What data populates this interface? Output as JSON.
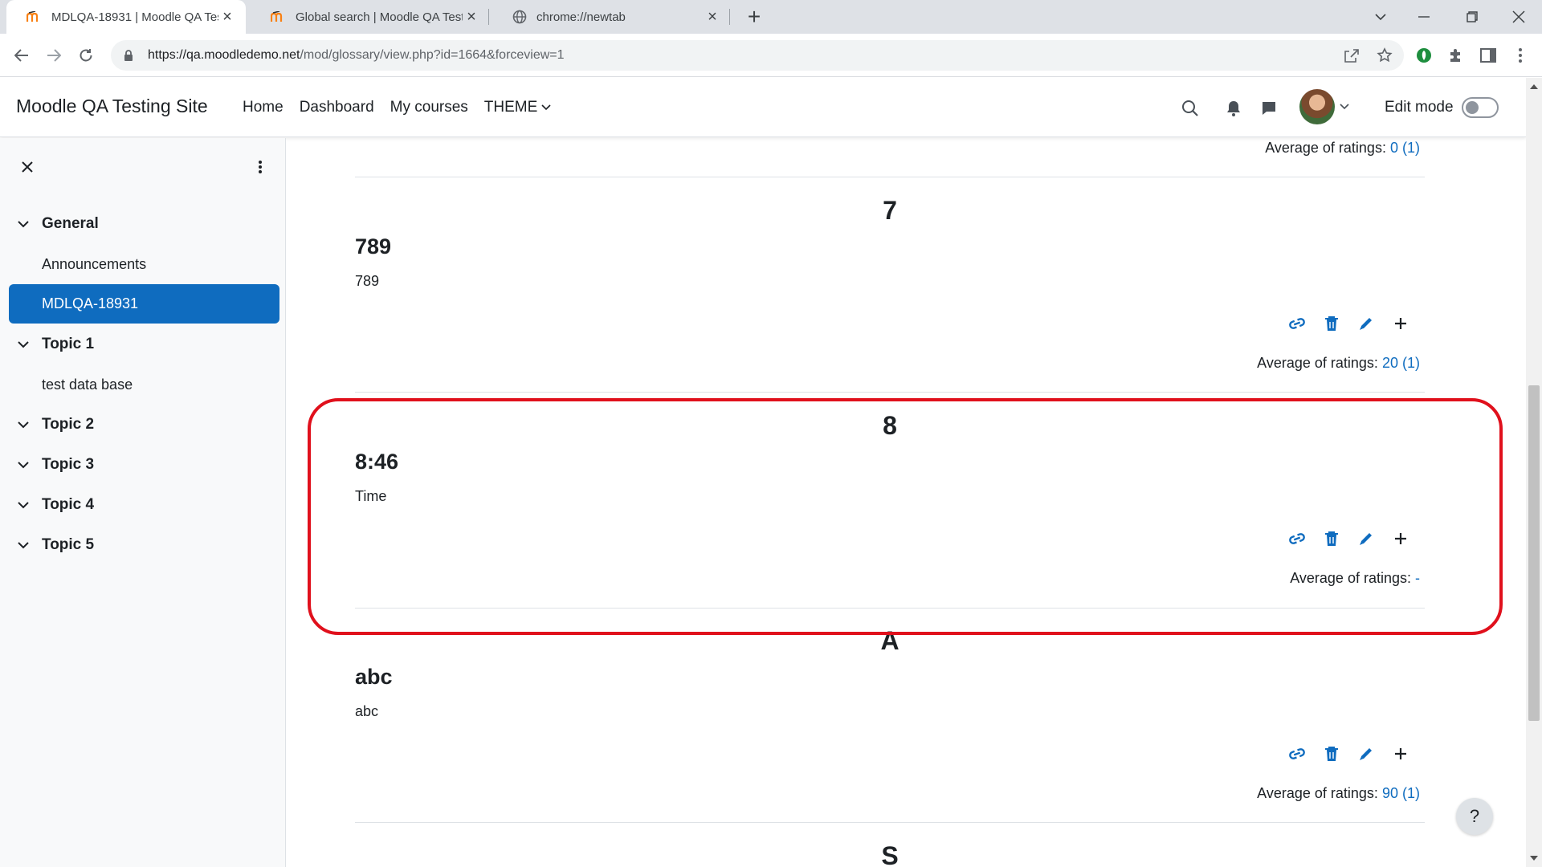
{
  "browser": {
    "tabs": [
      {
        "title": "MDLQA-18931 | Moodle QA Testi",
        "active": true
      },
      {
        "title": "Global search | Moodle QA Testin",
        "active": false
      },
      {
        "title": "chrome://newtab",
        "active": false
      }
    ],
    "url_host": "https://qa.moodledemo.net",
    "url_path": "/mod/glossary/view.php?id=1664&forceview=1"
  },
  "site": {
    "name": "Moodle QA Testing Site",
    "nav": {
      "home": "Home",
      "dashboard": "Dashboard",
      "my_courses": "My courses",
      "theme": "THEME"
    },
    "edit_mode_label": "Edit mode"
  },
  "course_index": {
    "sections": [
      {
        "title": "General",
        "items": [
          "Announcements",
          "MDLQA-18931"
        ]
      },
      {
        "title": "Topic 1",
        "items": [
          "test data base"
        ]
      },
      {
        "title": "Topic 2",
        "items": []
      },
      {
        "title": "Topic 3",
        "items": []
      },
      {
        "title": "Topic 4",
        "items": []
      },
      {
        "title": "Topic 5",
        "items": []
      }
    ],
    "active_item": "MDLQA-18931"
  },
  "glossary": {
    "rating_label": "Average of ratings:",
    "top_rating": {
      "value": "0",
      "count": "(1)"
    },
    "entries": [
      {
        "letter": "7",
        "concept": "789",
        "definition": "789",
        "rating_value": "20",
        "rating_count": "(1)"
      },
      {
        "letter": "8",
        "concept": "8:46",
        "definition": "Time",
        "rating_value": "-",
        "rating_count": ""
      },
      {
        "letter": "A",
        "concept": "abc",
        "definition": "abc",
        "rating_value": "90",
        "rating_count": "(1)"
      },
      {
        "letter": "S"
      }
    ]
  },
  "help_label": "?"
}
